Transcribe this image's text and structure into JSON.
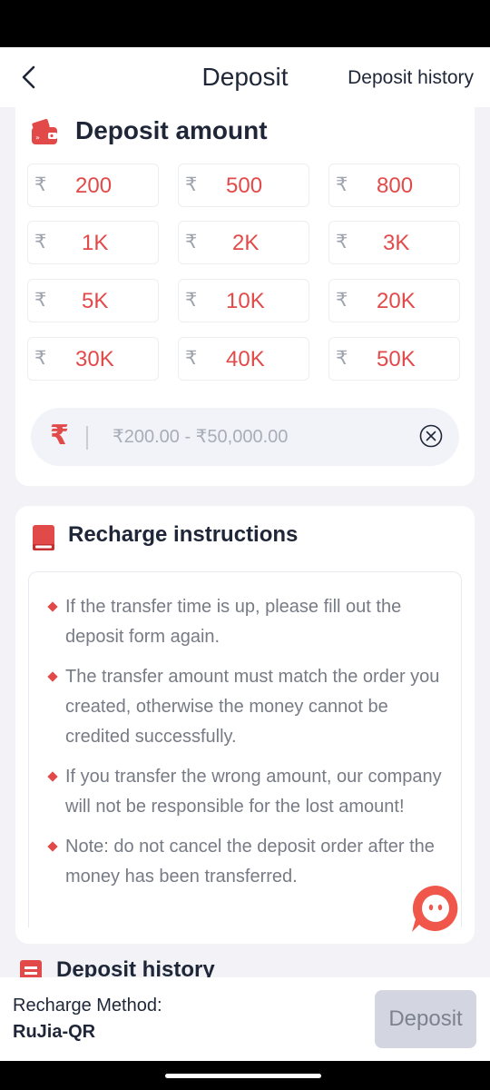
{
  "header": {
    "title": "Deposit",
    "history_link": "Deposit history"
  },
  "amount_section": {
    "title": "Deposit amount",
    "currency_symbol": "₹",
    "options": [
      "200",
      "500",
      "800",
      "1K",
      "2K",
      "3K",
      "5K",
      "10K",
      "20K",
      "30K",
      "40K",
      "50K"
    ],
    "input": {
      "currency_symbol": "₹",
      "placeholder": "₹200.00 - ₹50,000.00"
    }
  },
  "instructions": {
    "title": "Recharge instructions",
    "items": [
      "If the transfer time is up, please fill out the deposit form again.",
      "The transfer amount must match the order you created, otherwise the money cannot be credited successfully.",
      "If you transfer the wrong amount, our company will not be responsible for the lost amount!",
      "Note: do not cancel the deposit order after the money has been transferred."
    ]
  },
  "history_section": {
    "title": "Deposit history"
  },
  "footer": {
    "method_label": "Recharge Method:",
    "method_value": "RuJia-QR",
    "deposit_button": "Deposit"
  },
  "colors": {
    "accent": "#e24a4a",
    "disabled_button": "#d3d6e0",
    "background": "#f2f2f7"
  },
  "icons": {
    "back": "chevron-left-icon",
    "wallet": "wallet-icon",
    "clear": "clear-circle-icon",
    "book": "book-icon",
    "support": "chat-support-icon",
    "history": "document-icon"
  }
}
